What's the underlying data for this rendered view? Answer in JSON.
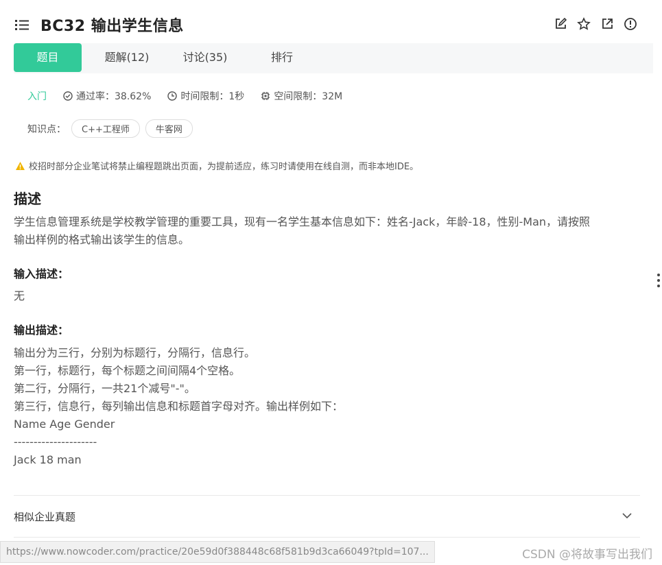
{
  "header": {
    "title": "BC32  输出学生信息"
  },
  "tabs": [
    {
      "label": "题目"
    },
    {
      "label": "题解(12)"
    },
    {
      "label": "讨论(35)"
    },
    {
      "label": "排行"
    }
  ],
  "meta": {
    "level": "入门",
    "pass_rate": "通过率：38.62%",
    "time_limit": "时间限制：1秒",
    "space_limit": "空间限制：32M"
  },
  "knowledge": {
    "label": "知识点：",
    "tags": [
      "C++工程师",
      "牛客网"
    ]
  },
  "warning": "校招时部分企业笔试将禁止编程题跳出页面，为提前适应，练习时请使用在线自测，而非本地IDE。",
  "description": {
    "heading": "描述",
    "line1": "学生信息管理系统是学校教学管理的重要工具，现有一名学生基本信息如下：姓名-Jack，年龄-18，性别-Man，请按照",
    "line2": "输出样例的格式输出该学生的信息。"
  },
  "input": {
    "heading": "输入描述：",
    "text": "无"
  },
  "output": {
    "heading": "输出描述：",
    "lines": [
      "输出分为三行，分别为标题行，分隔行，信息行。",
      "第一行，标题行，每个标题之间间隔4个空格。",
      "第二行，分隔行，一共21个减号\"-\"。",
      "第三行，信息行，每列输出信息和标题首字母对齐。输出样例如下：",
      "Name Age Gender",
      "---------------------",
      "Jack 18 man"
    ]
  },
  "similar": {
    "label": "相似企业真题"
  },
  "status_url": "https://www.nowcoder.com/practice/20e59d0f388448c68f581b9d3ca66049?tpId=107...",
  "watermark": "CSDN @将故事写出我们",
  "colors": {
    "accent": "#32ca99",
    "tab_bg": "#f6f7f8"
  },
  "icons": [
    "list-icon",
    "edit-icon",
    "star-icon",
    "share-icon",
    "info-icon",
    "check-circle-icon",
    "clock-icon",
    "chip-icon",
    "warning-icon",
    "chevron-down-icon"
  ]
}
